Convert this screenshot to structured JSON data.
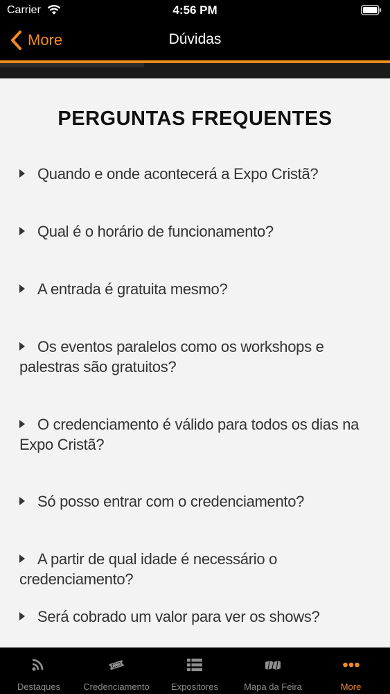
{
  "status_bar": {
    "carrier": "Carrier",
    "time": "4:56 PM"
  },
  "nav": {
    "back_label": "More",
    "title": "Dúvidas"
  },
  "progress": {
    "fraction": 0.37
  },
  "faq": {
    "heading": "PERGUNTAS FREQUENTES",
    "questions": [
      "Quando e onde acontecerá a Expo Cristã?",
      "Qual é o horário de funcionamento?",
      "A entrada é gratuita mesmo?",
      "Os eventos paralelos como os workshops e palestras são gratuitos?",
      "O credenciamento é válido para todos os dias na Expo Cristã?",
      "Só posso entrar com o credenciamento?",
      "A partir de qual idade é necessário o credenciamento?",
      "Será cobrado um valor para ver os shows?"
    ]
  },
  "tabs": [
    {
      "label": "Destaques",
      "icon": "rss-icon"
    },
    {
      "label": "Credenciamento",
      "icon": "ticket-icon"
    },
    {
      "label": "Expositores",
      "icon": "list-icon"
    },
    {
      "label": "Mapa da Feira",
      "icon": "map-icon"
    },
    {
      "label": "More",
      "icon": "more-dots-icon",
      "active": true
    }
  ],
  "colors": {
    "accent": "#f38a1d",
    "inactive": "#8e8e8e",
    "bar": "#000000",
    "content_bg": "#f3f3f3"
  }
}
